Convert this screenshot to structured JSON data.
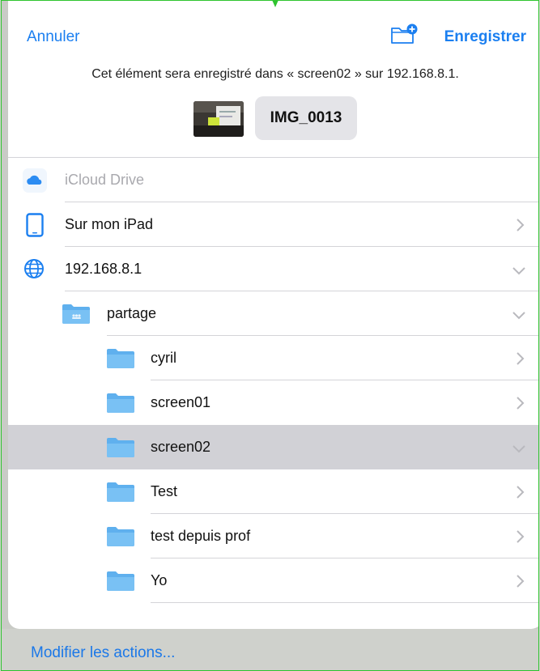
{
  "header": {
    "cancel_label": "Annuler",
    "save_label": "Enregistrer",
    "subtitle": "Cet élément sera enregistré dans « screen02 » sur 192.168.8.1.",
    "file_name": "IMG_0013"
  },
  "locations": [
    {
      "label": "iCloud Drive",
      "icon": "icloud-icon",
      "disabled": true
    },
    {
      "label": "Sur mon iPad",
      "icon": "ipad-icon",
      "chevron": "right"
    },
    {
      "label": "192.168.8.1",
      "icon": "globe-icon",
      "chevron": "down"
    },
    {
      "label": "partage",
      "icon": "shared-folder-icon",
      "chevron": "down"
    },
    {
      "label": "cyril",
      "icon": "folder-icon",
      "chevron": "right"
    },
    {
      "label": "screen01",
      "icon": "folder-icon",
      "chevron": "right"
    },
    {
      "label": "screen02",
      "icon": "folder-icon",
      "chevron": "down",
      "selected": true
    },
    {
      "label": "Test",
      "icon": "folder-icon",
      "chevron": "right"
    },
    {
      "label": "test depuis prof",
      "icon": "folder-icon",
      "chevron": "right"
    },
    {
      "label": "Yo",
      "icon": "folder-icon",
      "chevron": "right"
    }
  ],
  "footer": {
    "modify_actions_label": "Modifier les actions..."
  },
  "colors": {
    "accent": "#1b7ff0",
    "folder": "#62b4f0",
    "selected_row": "#d1d1d6"
  }
}
